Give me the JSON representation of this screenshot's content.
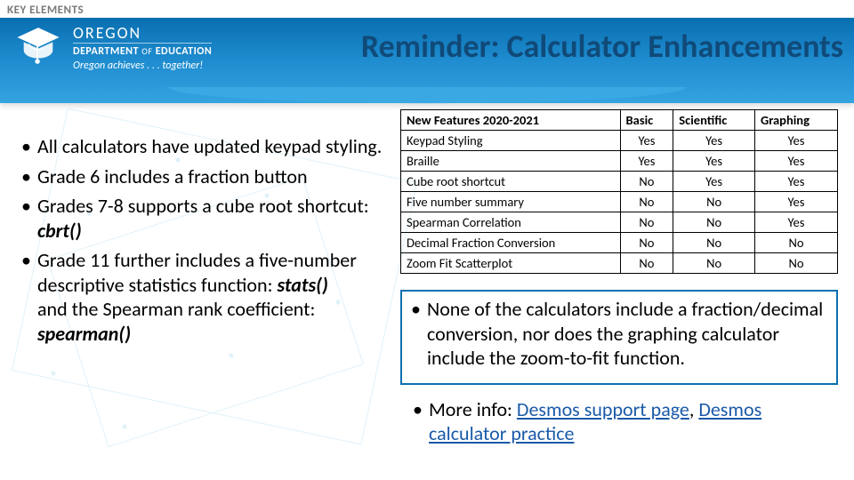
{
  "key_label": "KEY ELEMENTS",
  "title": "Reminder: Calculator Enhancements",
  "logo": {
    "line1": "OREGON",
    "line2a": "DEPARTMENT",
    "line2b": "OF",
    "line2c": "EDUCATION",
    "tagline": "Oregon achieves . . . together!"
  },
  "left_bullets": [
    {
      "text": "All calculators have updated keypad styling."
    },
    {
      "text": "Grade 6 includes a fraction button"
    },
    {
      "pre": "Grades 7-8 supports a cube root shortcut: ",
      "code": "cbrt()"
    },
    {
      "pre": "Grade 11 further includes a five-number descriptive statistics function: ",
      "code": "stats()",
      "mid": " and the Spearman rank coefficient: ",
      "code2": "spearman()"
    }
  ],
  "table": {
    "headers": [
      "New Features 2020-2021",
      "Basic",
      "Scientific",
      "Graphing"
    ],
    "rows": [
      [
        "Keypad Styling",
        "Yes",
        "Yes",
        "Yes"
      ],
      [
        "Braille",
        "Yes",
        "Yes",
        "Yes"
      ],
      [
        "Cube root shortcut",
        "No",
        "Yes",
        "Yes"
      ],
      [
        "Five number summary",
        "No",
        "No",
        "Yes"
      ],
      [
        "Spearman Correlation",
        "No",
        "No",
        "Yes"
      ],
      [
        "Decimal Fraction Conversion",
        "No",
        "No",
        "No"
      ],
      [
        "Zoom Fit Scatterplot",
        "No",
        "No",
        "No"
      ]
    ]
  },
  "box_note": "None of the calculators include a fraction/decimal conversion, nor does the graphing calculator include the zoom-to-fit function.",
  "more_info_label": "More info: ",
  "links": {
    "support": "Desmos support page",
    "practice": "Desmos calculator practice"
  }
}
